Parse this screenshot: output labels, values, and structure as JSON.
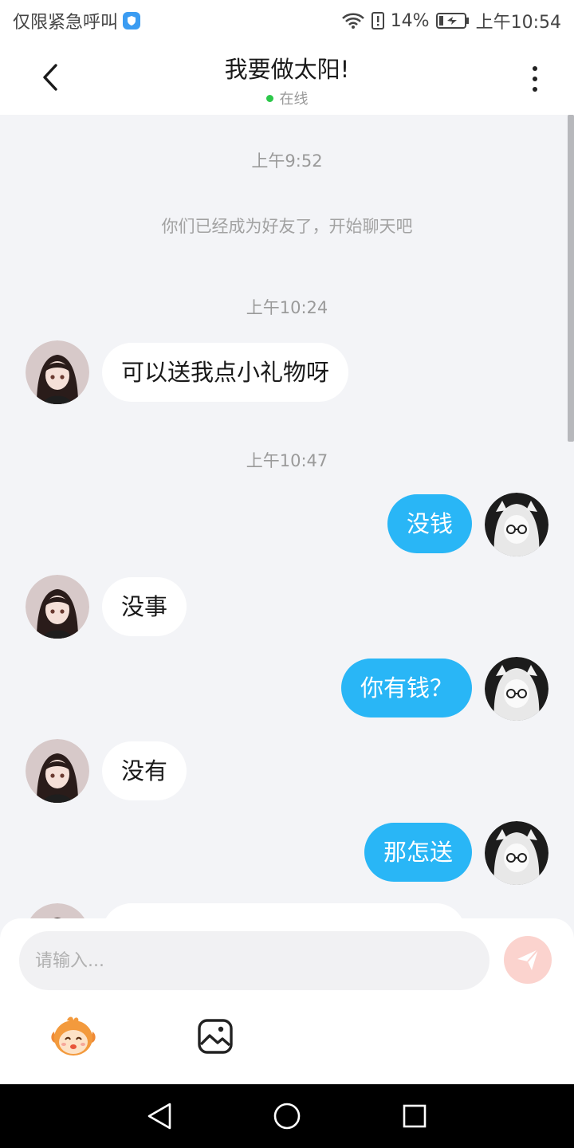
{
  "status_bar": {
    "carrier_text": "仅限紧急呼叫",
    "battery": "14%",
    "time": "上午10:54"
  },
  "header": {
    "title": "我要做太阳!",
    "status": "在线"
  },
  "chat": {
    "messages": [
      {
        "type": "timestamp",
        "text": "上午9:52"
      },
      {
        "type": "system",
        "text": "你们已经成为好友了，开始聊天吧"
      },
      {
        "type": "timestamp",
        "text": "上午10:24"
      },
      {
        "type": "incoming",
        "text": "可以送我点小礼物呀"
      },
      {
        "type": "timestamp",
        "text": "上午10:47"
      },
      {
        "type": "outgoing",
        "text": "没钱"
      },
      {
        "type": "incoming",
        "text": "没事"
      },
      {
        "type": "outgoing",
        "text": "你有钱？"
      },
      {
        "type": "incoming",
        "text": "没有"
      },
      {
        "type": "outgoing",
        "text": "那怎送"
      }
    ]
  },
  "input": {
    "placeholder": "请输入..."
  },
  "icons": {
    "back": "back-arrow-icon",
    "more": "more-vertical-icon",
    "send": "send-icon",
    "emoji": "emoji-mascot-icon",
    "image": "image-icon",
    "nav_back": "nav-back-icon",
    "nav_home": "nav-home-icon",
    "nav_recents": "nav-recents-icon"
  },
  "colors": {
    "accent": "#29b6f6",
    "online": "#2cc84a",
    "send_disabled": "#fbd3ce",
    "background": "#f3f4f7"
  }
}
